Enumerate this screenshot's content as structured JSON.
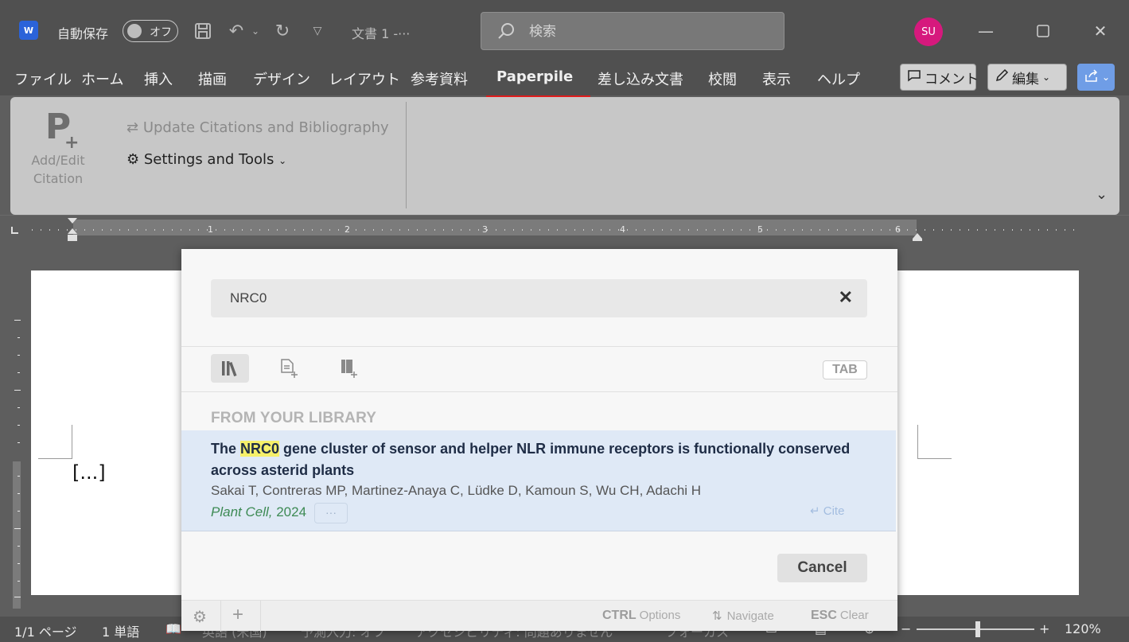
{
  "titlebar": {
    "app_logo": "W",
    "autosave_label": "自動保存",
    "autosave_state": "オフ",
    "doc_title": "文書 1  -···",
    "search_placeholder": "検索",
    "avatar_initials": "SU",
    "icons": [
      "save-icon",
      "undo-icon",
      "redo-icon",
      "customize-icon",
      "minimize-icon",
      "maximize-icon",
      "close-icon"
    ]
  },
  "menu": {
    "items": [
      "ファイル",
      "ホーム",
      "挿入",
      "描画",
      "デザイン",
      "レイアウト",
      "参考資料",
      "Paperpile",
      "差し込み文書",
      "校閲",
      "表示",
      "ヘルプ"
    ],
    "active": "Paperpile",
    "comment_label": "コメント",
    "edit_label": "編集"
  },
  "ribbon": {
    "add_edit_label": "Add/Edit Citation",
    "update_label": "Update Citations and Bibliography",
    "settings_label": "Settings and Tools"
  },
  "ruler": {
    "numbers": [
      "1",
      "2",
      "3",
      "4",
      "5",
      "6"
    ]
  },
  "document": {
    "body_text": "[...]"
  },
  "dialog": {
    "query": "NRC0",
    "tab_key": "TAB",
    "section_heading": "FROM YOUR LIBRARY",
    "result": {
      "title_before": "The ",
      "title_highlight": "NRC0",
      "title_after": " gene cluster of sensor and helper NLR immune receptors is functionally conserved across asterid plants",
      "authors": "Sakai T, Contreras MP, Martinez-Anaya C, Lüdke D, Kamoun S, Wu CH, Adachi H",
      "journal": "Plant Cell,",
      "year": "2024",
      "more": "···",
      "cite_label": "Cite"
    },
    "cancel_label": "Cancel",
    "footer": {
      "ctrl_key": "CTRL",
      "ctrl_label": "Options",
      "nav_label": "Navigate",
      "esc_key": "ESC",
      "esc_label": "Clear"
    }
  },
  "statusbar": {
    "page": "1/1 ページ",
    "words": "1 単語",
    "language": "英語 (米国)",
    "predict": "予測入力: オフ",
    "accessibility": "アクセシビリティ: 問題ありません",
    "focus": "フォーカス",
    "zoom": "120%"
  },
  "colors": {
    "accent_red": "#e01b1b",
    "avatar": "#d6197d",
    "highlight": "#f6f06a",
    "journal_green": "#3d8a54",
    "result_bg": "#dfe9f6"
  }
}
